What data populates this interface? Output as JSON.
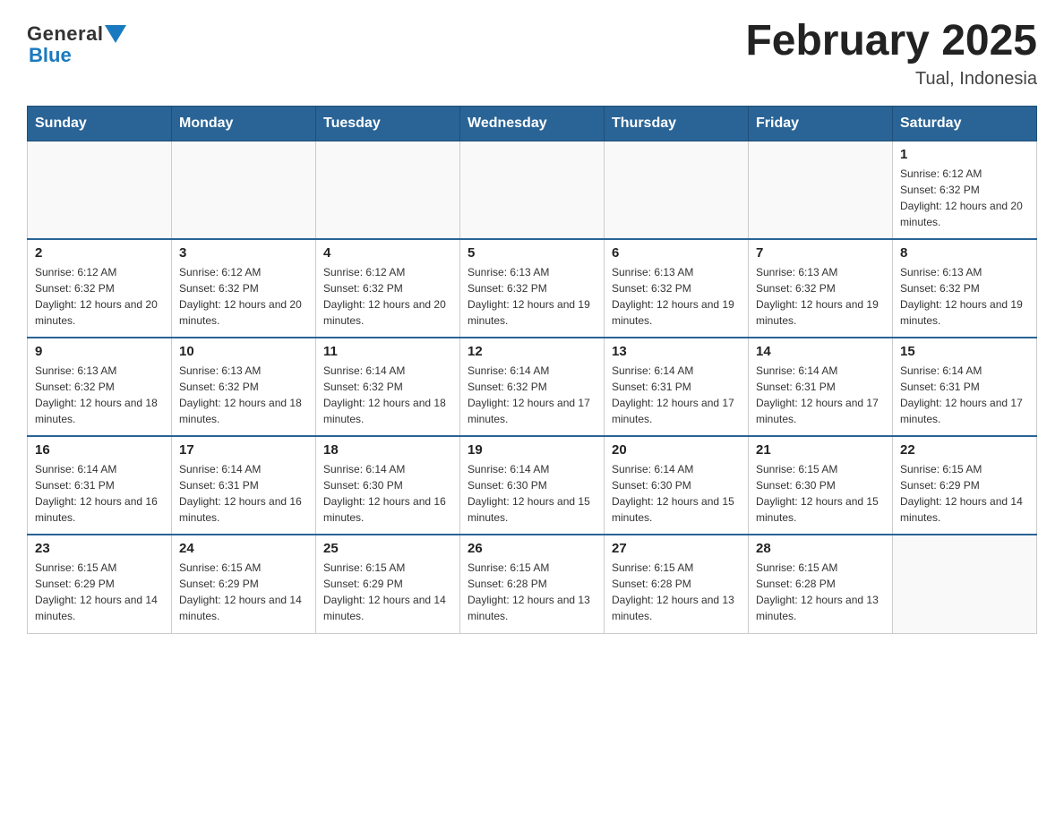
{
  "header": {
    "logo": {
      "part1": "General",
      "part2": "Blue"
    },
    "title": "February 2025",
    "location": "Tual, Indonesia"
  },
  "days_of_week": [
    "Sunday",
    "Monday",
    "Tuesday",
    "Wednesday",
    "Thursday",
    "Friday",
    "Saturday"
  ],
  "weeks": [
    [
      {
        "day": "",
        "info": ""
      },
      {
        "day": "",
        "info": ""
      },
      {
        "day": "",
        "info": ""
      },
      {
        "day": "",
        "info": ""
      },
      {
        "day": "",
        "info": ""
      },
      {
        "day": "",
        "info": ""
      },
      {
        "day": "1",
        "info": "Sunrise: 6:12 AM\nSunset: 6:32 PM\nDaylight: 12 hours and 20 minutes."
      }
    ],
    [
      {
        "day": "2",
        "info": "Sunrise: 6:12 AM\nSunset: 6:32 PM\nDaylight: 12 hours and 20 minutes."
      },
      {
        "day": "3",
        "info": "Sunrise: 6:12 AM\nSunset: 6:32 PM\nDaylight: 12 hours and 20 minutes."
      },
      {
        "day": "4",
        "info": "Sunrise: 6:12 AM\nSunset: 6:32 PM\nDaylight: 12 hours and 20 minutes."
      },
      {
        "day": "5",
        "info": "Sunrise: 6:13 AM\nSunset: 6:32 PM\nDaylight: 12 hours and 19 minutes."
      },
      {
        "day": "6",
        "info": "Sunrise: 6:13 AM\nSunset: 6:32 PM\nDaylight: 12 hours and 19 minutes."
      },
      {
        "day": "7",
        "info": "Sunrise: 6:13 AM\nSunset: 6:32 PM\nDaylight: 12 hours and 19 minutes."
      },
      {
        "day": "8",
        "info": "Sunrise: 6:13 AM\nSunset: 6:32 PM\nDaylight: 12 hours and 19 minutes."
      }
    ],
    [
      {
        "day": "9",
        "info": "Sunrise: 6:13 AM\nSunset: 6:32 PM\nDaylight: 12 hours and 18 minutes."
      },
      {
        "day": "10",
        "info": "Sunrise: 6:13 AM\nSunset: 6:32 PM\nDaylight: 12 hours and 18 minutes."
      },
      {
        "day": "11",
        "info": "Sunrise: 6:14 AM\nSunset: 6:32 PM\nDaylight: 12 hours and 18 minutes."
      },
      {
        "day": "12",
        "info": "Sunrise: 6:14 AM\nSunset: 6:32 PM\nDaylight: 12 hours and 17 minutes."
      },
      {
        "day": "13",
        "info": "Sunrise: 6:14 AM\nSunset: 6:31 PM\nDaylight: 12 hours and 17 minutes."
      },
      {
        "day": "14",
        "info": "Sunrise: 6:14 AM\nSunset: 6:31 PM\nDaylight: 12 hours and 17 minutes."
      },
      {
        "day": "15",
        "info": "Sunrise: 6:14 AM\nSunset: 6:31 PM\nDaylight: 12 hours and 17 minutes."
      }
    ],
    [
      {
        "day": "16",
        "info": "Sunrise: 6:14 AM\nSunset: 6:31 PM\nDaylight: 12 hours and 16 minutes."
      },
      {
        "day": "17",
        "info": "Sunrise: 6:14 AM\nSunset: 6:31 PM\nDaylight: 12 hours and 16 minutes."
      },
      {
        "day": "18",
        "info": "Sunrise: 6:14 AM\nSunset: 6:30 PM\nDaylight: 12 hours and 16 minutes."
      },
      {
        "day": "19",
        "info": "Sunrise: 6:14 AM\nSunset: 6:30 PM\nDaylight: 12 hours and 15 minutes."
      },
      {
        "day": "20",
        "info": "Sunrise: 6:14 AM\nSunset: 6:30 PM\nDaylight: 12 hours and 15 minutes."
      },
      {
        "day": "21",
        "info": "Sunrise: 6:15 AM\nSunset: 6:30 PM\nDaylight: 12 hours and 15 minutes."
      },
      {
        "day": "22",
        "info": "Sunrise: 6:15 AM\nSunset: 6:29 PM\nDaylight: 12 hours and 14 minutes."
      }
    ],
    [
      {
        "day": "23",
        "info": "Sunrise: 6:15 AM\nSunset: 6:29 PM\nDaylight: 12 hours and 14 minutes."
      },
      {
        "day": "24",
        "info": "Sunrise: 6:15 AM\nSunset: 6:29 PM\nDaylight: 12 hours and 14 minutes."
      },
      {
        "day": "25",
        "info": "Sunrise: 6:15 AM\nSunset: 6:29 PM\nDaylight: 12 hours and 14 minutes."
      },
      {
        "day": "26",
        "info": "Sunrise: 6:15 AM\nSunset: 6:28 PM\nDaylight: 12 hours and 13 minutes."
      },
      {
        "day": "27",
        "info": "Sunrise: 6:15 AM\nSunset: 6:28 PM\nDaylight: 12 hours and 13 minutes."
      },
      {
        "day": "28",
        "info": "Sunrise: 6:15 AM\nSunset: 6:28 PM\nDaylight: 12 hours and 13 minutes."
      },
      {
        "day": "",
        "info": ""
      }
    ]
  ]
}
